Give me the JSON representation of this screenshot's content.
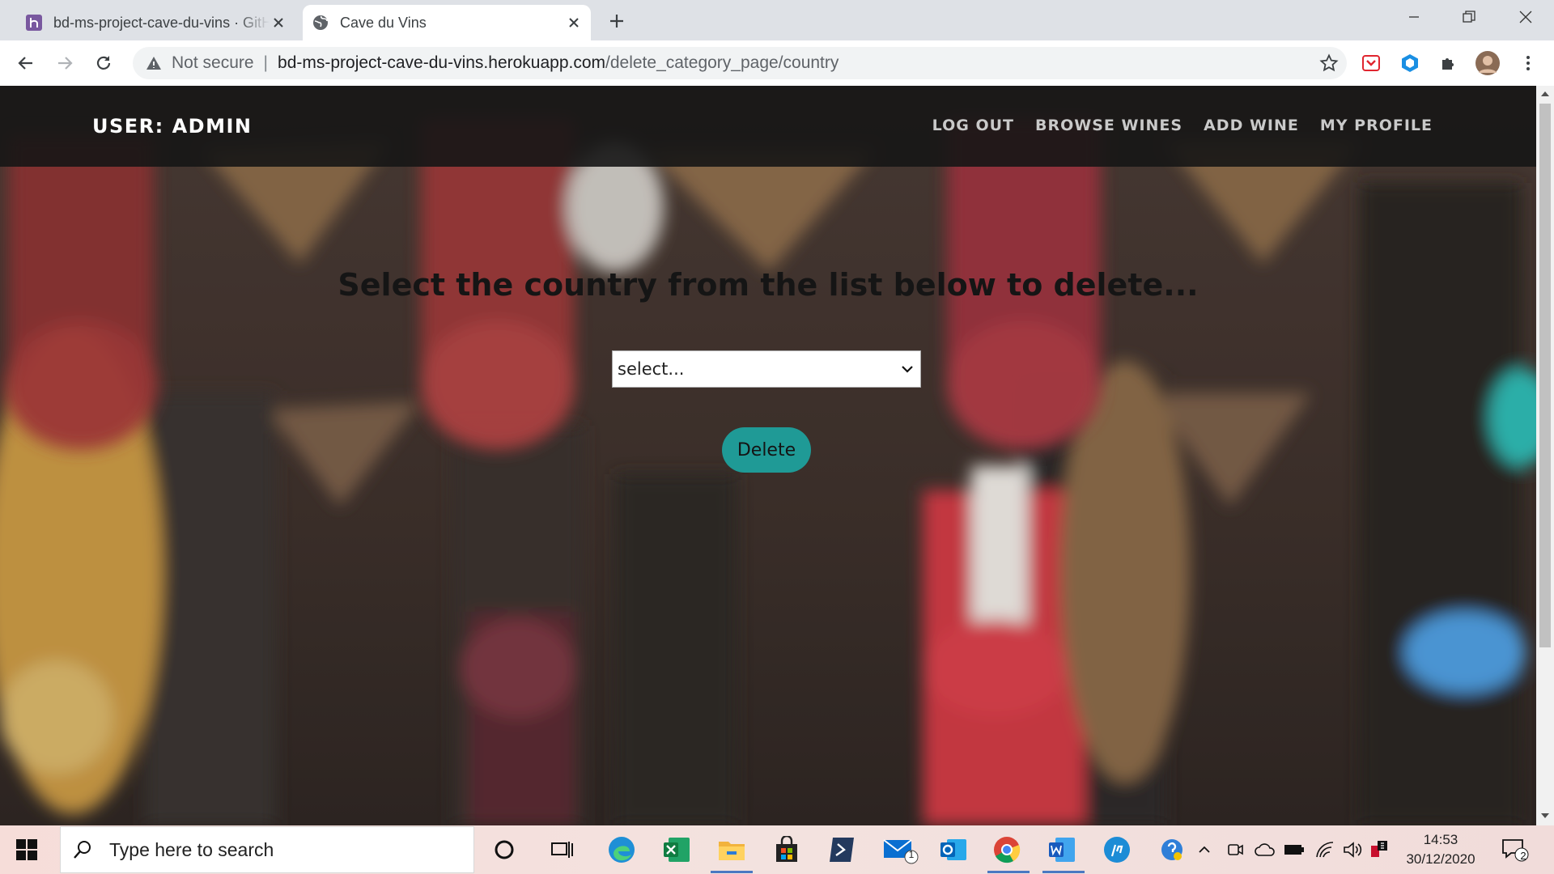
{
  "browser": {
    "tabs": [
      {
        "title": "bd-ms-project-cave-du-vins · GitHub",
        "active": false,
        "favicon": "heroku-icon"
      },
      {
        "title": "Cave du Vins",
        "active": true,
        "favicon": "globe-icon"
      }
    ],
    "address": {
      "security_label": "Not secure",
      "host": "bd-ms-project-cave-du-vins.herokuapp.com",
      "path": "/delete_category_page/country"
    }
  },
  "page": {
    "brand": "USER: ADMIN",
    "nav": [
      {
        "label": "LOG OUT"
      },
      {
        "label": "BROWSE WINES"
      },
      {
        "label": "ADD WINE"
      },
      {
        "label": "MY PROFILE"
      }
    ],
    "heading": "Select the country from the list below to delete...",
    "select": {
      "value": "select..."
    },
    "delete_label": "Delete",
    "colors": {
      "navbar": "#161616",
      "button": "#1f9a96",
      "heading": "#151515"
    }
  },
  "taskbar": {
    "search_placeholder": "Type here to search",
    "time": "14:53",
    "date": "30/12/2020",
    "mail_badge": "1",
    "notification_count": "2"
  }
}
